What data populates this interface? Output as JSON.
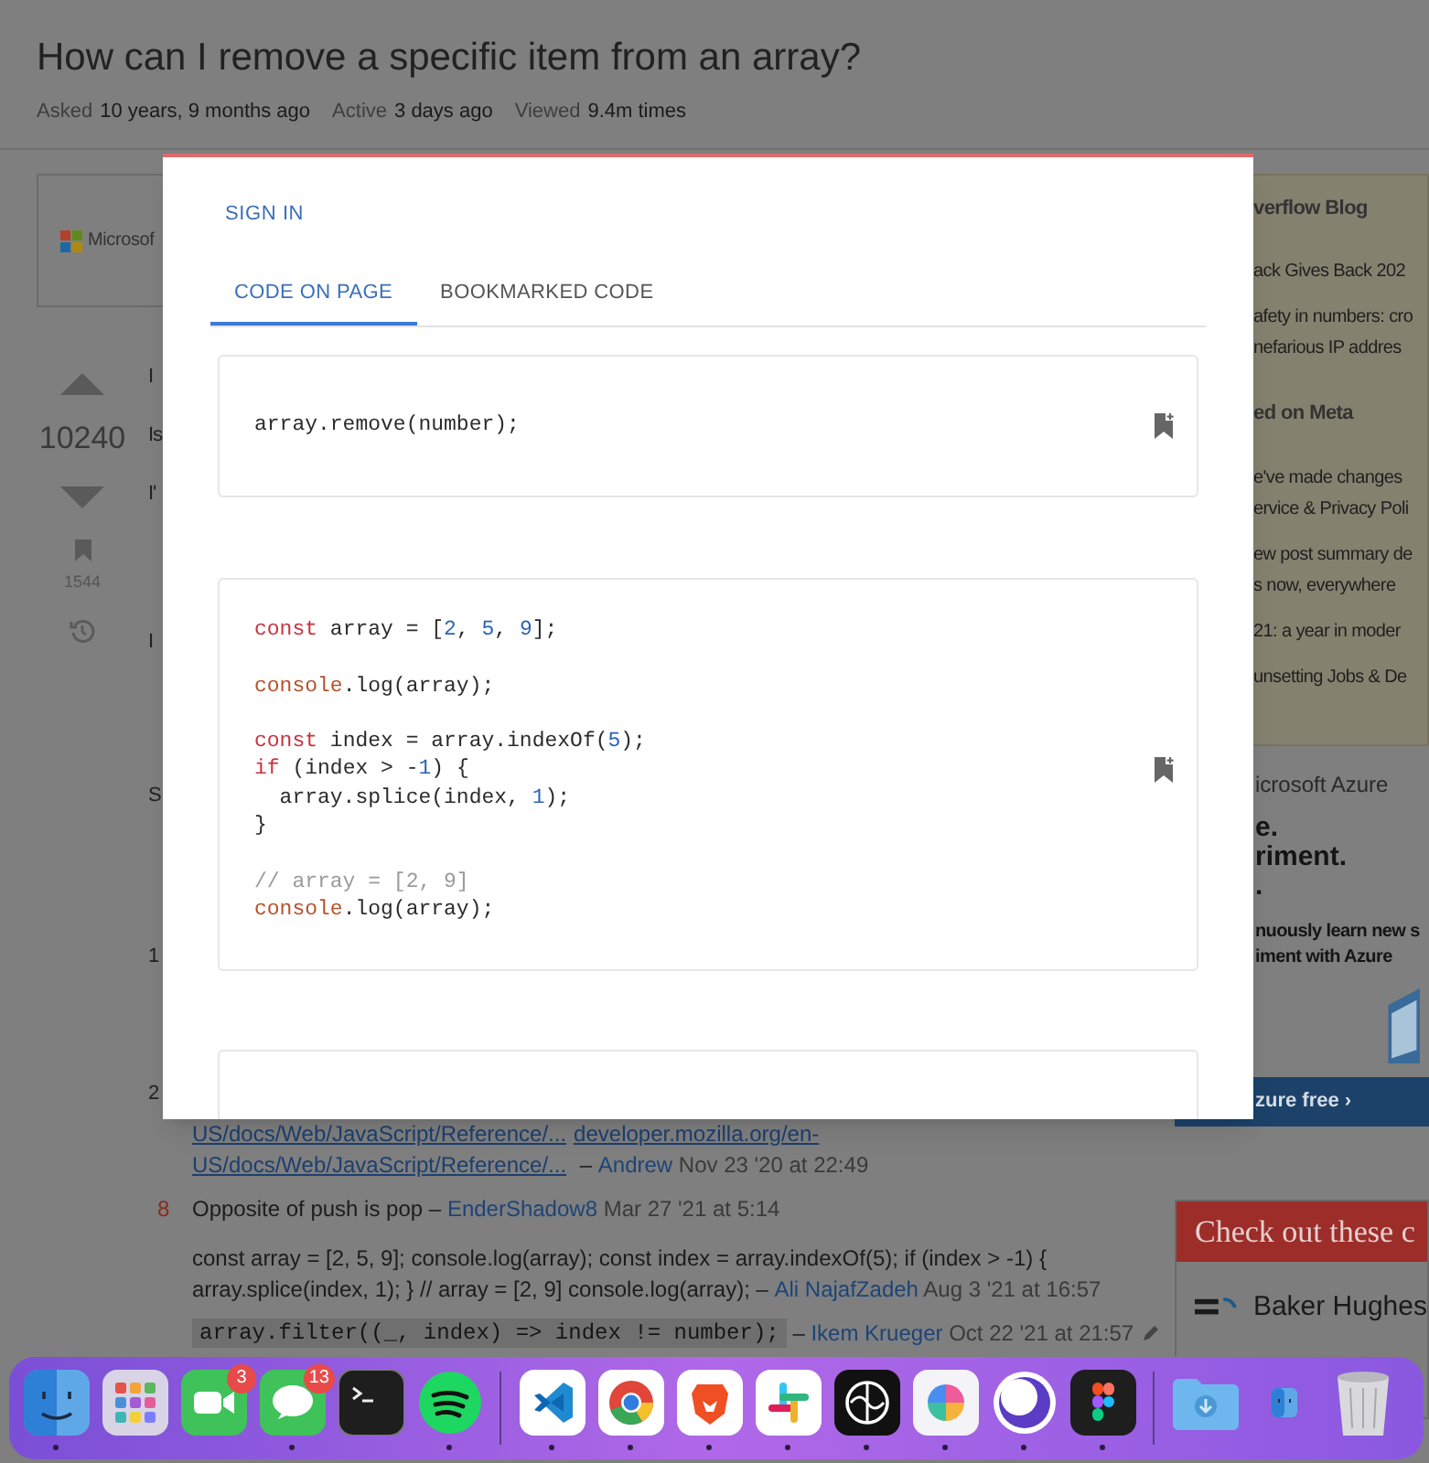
{
  "question": {
    "title": "How can I remove a specific item from an array?",
    "meta": [
      {
        "label": "Asked",
        "value": "10 years, 9 months ago"
      },
      {
        "label": "Active",
        "value": "3 days ago"
      },
      {
        "label": "Viewed",
        "value": "9.4m times"
      }
    ]
  },
  "ad": {
    "text": "Microsof"
  },
  "votes": {
    "score": "10240",
    "bookmarks": "1544"
  },
  "post_fragments": [
    "I",
    "Is",
    "I'",
    "I",
    "S",
    "1",
    "2"
  ],
  "comments": [
    {
      "lines": [
        [
          {
            "kind": "link",
            "text": "US/docs/Web/JavaScript/Reference/..."
          },
          {
            "kind": "link",
            "text": "developer.mozilla.org/en-"
          }
        ],
        [
          {
            "kind": "link",
            "text": "US/docs/Web/JavaScript/Reference/..."
          },
          {
            "kind": "text",
            "text": " – "
          },
          {
            "kind": "user",
            "text": "Andrew"
          },
          {
            "kind": "date",
            "text": " Nov 23 '20 at 22:49"
          }
        ]
      ]
    },
    {
      "vote": "8",
      "lines": [
        [
          {
            "kind": "text",
            "text": "Opposite of push is pop – "
          },
          {
            "kind": "user",
            "text": "EnderShadow8"
          },
          {
            "kind": "date",
            "text": " Mar 27 '21 at 5:14"
          }
        ]
      ]
    },
    {
      "lines": [
        [
          {
            "kind": "text",
            "text": "const array = [2, 5, 9]; console.log(array); const index = array.indexOf(5); if (index > -1) {"
          }
        ],
        [
          {
            "kind": "text",
            "text": "array.splice(index, 1); } // array = [2, 9] console.log(array); – "
          },
          {
            "kind": "user",
            "text": "Ali NajafZadeh"
          },
          {
            "kind": "date",
            "text": " Aug 3 '21 at 16:57"
          }
        ]
      ]
    },
    {
      "edited": true,
      "lines": [
        [
          {
            "kind": "code",
            "text": "array.filter((_, index) => index != number);"
          },
          {
            "kind": "text",
            "text": " – "
          },
          {
            "kind": "user",
            "text": "Ikem Krueger"
          },
          {
            "kind": "date",
            "text": " Oct 22 '21 at 21:57"
          }
        ]
      ]
    }
  ],
  "sidebar": {
    "blog_heading": "verflow Blog",
    "blog_items": [
      [
        "ack Gives Back 202"
      ],
      [
        "afety in numbers: cro",
        "nefarious IP addres"
      ]
    ],
    "meta_heading": "ed on Meta",
    "meta_items": [
      [
        "e've made changes",
        "ervice & Privacy Poli"
      ],
      [
        "ew post summary de",
        "s now, everywhere"
      ],
      [
        "21: a year in moder"
      ],
      [
        "unsetting Jobs & De"
      ]
    ]
  },
  "azure_ad": {
    "title": "icrosoft Azure",
    "headline": [
      "e.",
      "riment.",
      "."
    ],
    "subtext": [
      "nuously learn new s",
      "iment with Azure"
    ],
    "button": "zure free ›"
  },
  "jobs": {
    "heading": "Check out these c",
    "company": "Baker Hughes"
  },
  "extension": {
    "sign_in": "SIGN IN",
    "tabs": [
      {
        "label": "CODE ON PAGE",
        "selected": true
      },
      {
        "label": "BOOKMARKED CODE",
        "selected": false
      }
    ],
    "snippets": [
      {
        "lines": [
          {
            "kind": "code",
            "tokens": [
              {
                "kind": "plain",
                "text": "array.remove(number);"
              }
            ]
          }
        ]
      },
      {
        "lines": [
          {
            "kind": "code",
            "tokens": [
              {
                "kind": "keyword",
                "text": "const"
              },
              {
                "kind": "plain",
                "text": " array = ["
              },
              {
                "kind": "number",
                "text": "2"
              },
              {
                "kind": "plain",
                "text": ", "
              },
              {
                "kind": "number",
                "text": "5"
              },
              {
                "kind": "plain",
                "text": ", "
              },
              {
                "kind": "number",
                "text": "9"
              },
              {
                "kind": "plain",
                "text": "];"
              }
            ]
          },
          {
            "kind": "blank"
          },
          {
            "kind": "code",
            "tokens": [
              {
                "kind": "builtin",
                "text": "console"
              },
              {
                "kind": "plain",
                "text": ".log(array);"
              }
            ]
          },
          {
            "kind": "blank"
          },
          {
            "kind": "code",
            "tokens": [
              {
                "kind": "keyword",
                "text": "const"
              },
              {
                "kind": "plain",
                "text": " index = array.indexOf("
              },
              {
                "kind": "number",
                "text": "5"
              },
              {
                "kind": "plain",
                "text": ");"
              }
            ]
          },
          {
            "kind": "code",
            "tokens": [
              {
                "kind": "keyword",
                "text": "if"
              },
              {
                "kind": "plain",
                "text": " (index > -"
              },
              {
                "kind": "number",
                "text": "1"
              },
              {
                "kind": "plain",
                "text": ") {"
              }
            ]
          },
          {
            "kind": "code",
            "tokens": [
              {
                "kind": "plain",
                "text": "  array.splice(index, "
              },
              {
                "kind": "number",
                "text": "1"
              },
              {
                "kind": "plain",
                "text": ");"
              }
            ]
          },
          {
            "kind": "code",
            "tokens": [
              {
                "kind": "plain",
                "text": "}"
              }
            ]
          },
          {
            "kind": "blank"
          },
          {
            "kind": "code",
            "tokens": [
              {
                "kind": "comment",
                "text": "// array = [2, 9]"
              }
            ]
          },
          {
            "kind": "code",
            "tokens": [
              {
                "kind": "builtin",
                "text": "console"
              },
              {
                "kind": "plain",
                "text": ".log(array);"
              }
            ]
          }
        ]
      }
    ]
  },
  "dock": [
    {
      "kind": "finder",
      "running": true
    },
    {
      "kind": "launchpad",
      "running": false
    },
    {
      "kind": "facetime",
      "running": false,
      "badge": "3"
    },
    {
      "kind": "messages",
      "running": true,
      "badge": "13"
    },
    {
      "kind": "terminal",
      "running": false
    },
    {
      "kind": "spotify",
      "running": true
    },
    {
      "kind": "separator"
    },
    {
      "kind": "vscode",
      "running": true
    },
    {
      "kind": "chrome",
      "running": true
    },
    {
      "kind": "brave",
      "running": true
    },
    {
      "kind": "slack",
      "running": true
    },
    {
      "kind": "knot",
      "running": true
    },
    {
      "kind": "petals",
      "running": true
    },
    {
      "kind": "ring",
      "running": true
    },
    {
      "kind": "figma",
      "running": true
    },
    {
      "kind": "separator"
    },
    {
      "kind": "downloads",
      "running": false
    },
    {
      "kind": "minifinder",
      "running": false
    },
    {
      "kind": "trash",
      "running": false
    }
  ]
}
